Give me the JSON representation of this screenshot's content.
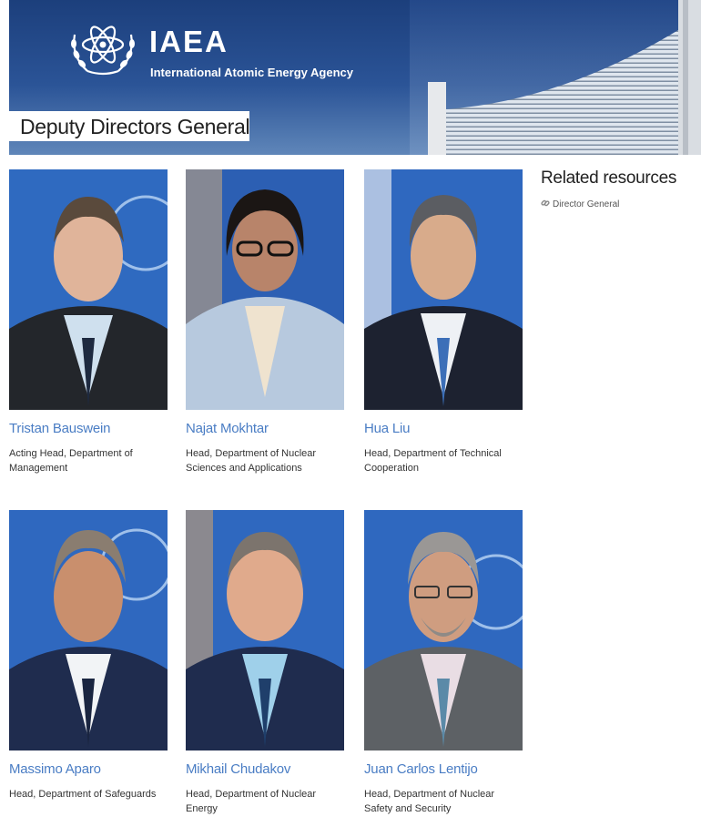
{
  "header": {
    "logo_text": "IAEA",
    "logo_subtitle": "International Atomic Energy Agency",
    "page_title": "Deputy Directors General"
  },
  "sidebar": {
    "title": "Related resources",
    "links": [
      {
        "label": "Director General",
        "icon": "link-icon"
      }
    ]
  },
  "people": [
    {
      "name": "Tristan Bauswein",
      "role": "Acting Head, Department of Management"
    },
    {
      "name": "Najat Mokhtar",
      "role": "Head, Department of Nuclear Sciences and Applications"
    },
    {
      "name": "Hua Liu",
      "role": "Head, Department of Technical Cooperation"
    },
    {
      "name": "Massimo Aparo",
      "role": "Head, Department of Safeguards"
    },
    {
      "name": "Mikhail Chudakov",
      "role": "Head, Department of Nuclear Energy"
    },
    {
      "name": "Juan Carlos Lentijo",
      "role": "Head, Department of Nuclear Safety and Security"
    }
  ],
  "colors": {
    "banner": "#2b5497",
    "name_link": "#4a7dc4",
    "photo_background": "#2c63b4"
  }
}
